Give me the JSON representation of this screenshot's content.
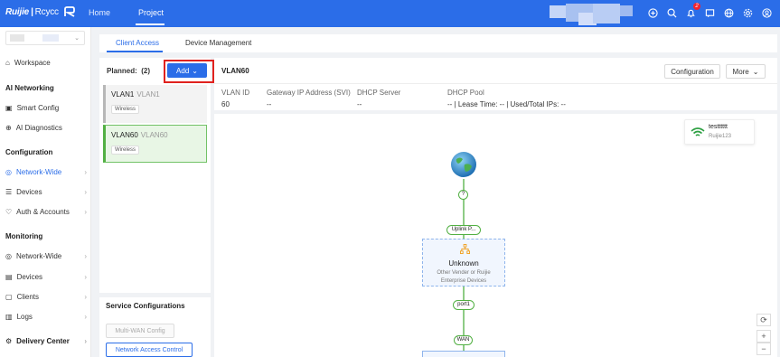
{
  "topbar": {
    "logo_brand": "Ruijie",
    "logo_product": "Rcycc",
    "tabs": [
      "Home",
      "Project"
    ],
    "active_tab": "Project",
    "notification_count": "2",
    "icons": [
      "add-circle-icon",
      "search-icon",
      "bell-icon",
      "message-icon",
      "globe-icon",
      "settings-icon",
      "user-icon"
    ]
  },
  "sidebar": {
    "workspace": "Workspace",
    "sections": [
      {
        "heading": "AI Networking",
        "items": [
          "Smart Config",
          "AI Diagnostics"
        ]
      },
      {
        "heading": "Configuration",
        "items": [
          "Network-Wide",
          "Devices",
          "Auth & Accounts"
        ]
      },
      {
        "heading": "Monitoring",
        "items": [
          "Network-Wide",
          "Devices",
          "Clients",
          "Logs"
        ]
      }
    ],
    "delivery_center": "Delivery Center",
    "active_item": "Network-Wide"
  },
  "tabs": [
    "Client Access",
    "Device Management"
  ],
  "active_tab": "Client Access",
  "left_panel": {
    "planned_label": "Planned:",
    "planned_count": "(2)",
    "add_label": "Add",
    "vlans": [
      {
        "name": "VLAN1",
        "alias": "VLAN1",
        "tag": "Wireless",
        "selected": false
      },
      {
        "name": "VLAN60",
        "alias": "VLAN60",
        "tag": "Wireless",
        "selected": true
      }
    ],
    "service_title": "Service Configurations",
    "service_buttons": [
      "Multi-WAN Config",
      "Network Access Control"
    ]
  },
  "detail": {
    "title": "VLAN60",
    "configuration_label": "Configuration",
    "more_label": "More",
    "fields": [
      {
        "label": "VLAN ID",
        "value": "60"
      },
      {
        "label": "Gateway IP Address (SVI)",
        "value": "--"
      },
      {
        "label": "DHCP Server",
        "value": "--"
      },
      {
        "label": "DHCP Pool",
        "value": "-- | Lease Time: -- | Used/Total IPs: --"
      }
    ]
  },
  "topology": {
    "wifi_ssid": "testttttt",
    "wifi_password": "Ruijie123",
    "question_label": "?",
    "uplink_label": "Uplink P...",
    "device_name": "Unknown",
    "device_desc_1": "Other Vender or Ruijie",
    "device_desc_2": "Enterprise Devices",
    "port_label": "port1",
    "wan_label": "WAN"
  },
  "colors": {
    "primary": "#2b6de8",
    "green": "#52b043",
    "highlight": "#e0221e"
  }
}
